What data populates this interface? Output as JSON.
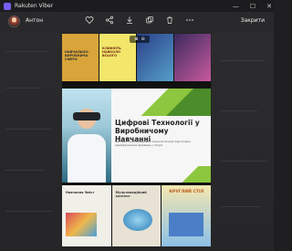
{
  "window": {
    "title": "Rakuten Viber",
    "minimize": "—",
    "maximize": "☐",
    "close": "✕"
  },
  "header": {
    "user_name": "Антон",
    "close_label": "Закрити"
  },
  "toolbar": {
    "icons": [
      "heart-icon",
      "share-icon",
      "download-icon",
      "forward-icon",
      "delete-icon",
      "more-icon"
    ]
  },
  "slide": {
    "title": "Цифрові Технології у Виробничому Навчанні",
    "text": "Використання цифрових технологій для підготовки кваліфікованих фахівців у галузі"
  },
  "thumbs_top": [
    {
      "label": "НАВЧАЛЬНО-ВИРОБНИЧА СФЕРА",
      "bg": "#d9a53a"
    },
    {
      "label": "КЛИКНІТЬ НАВКОЛО ВСЬОГО",
      "bg": "#f2e66b"
    },
    {
      "label": "",
      "bg": "#2b3f8a"
    },
    {
      "label": "",
      "bg": "#3c2a5e"
    }
  ],
  "thumbs_bottom": [
    {
      "label": "Навчання Зміст",
      "bg": "#f0efe8"
    },
    {
      "label": "Мультимедійний контент",
      "bg": "#e8e2d4"
    },
    {
      "label": "КРУГЛИЙ СТІЛ",
      "bg": "#f5e7b0"
    }
  ]
}
